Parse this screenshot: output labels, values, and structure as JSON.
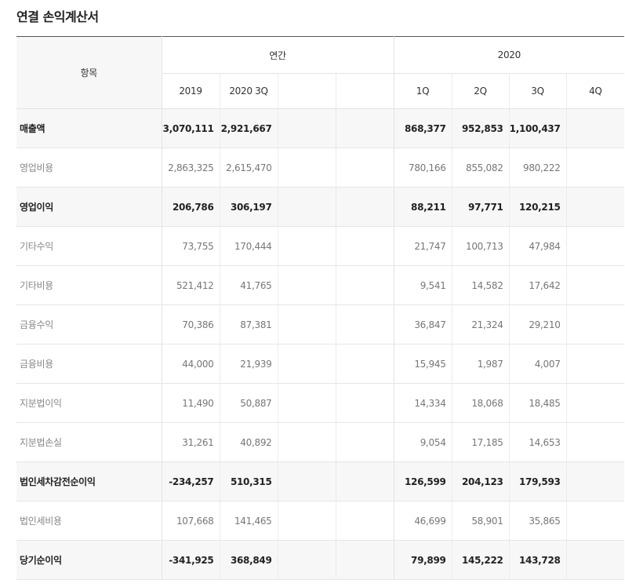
{
  "title": "연결 손익계산서",
  "table": {
    "item_header": "항목",
    "group_annual": "연간",
    "group_quarterly": "2020",
    "columns": [
      "2019",
      "2020 3Q",
      "",
      "",
      "1Q",
      "2Q",
      "3Q",
      "4Q"
    ],
    "rows": [
      {
        "label": "매출액",
        "emphasis": true,
        "values": [
          "3,070,111",
          "2,921,667",
          "",
          "",
          "868,377",
          "952,853",
          "1,100,437",
          ""
        ]
      },
      {
        "label": "영업비용",
        "emphasis": false,
        "values": [
          "2,863,325",
          "2,615,470",
          "",
          "",
          "780,166",
          "855,082",
          "980,222",
          ""
        ]
      },
      {
        "label": "영업이익",
        "emphasis": true,
        "values": [
          "206,786",
          "306,197",
          "",
          "",
          "88,211",
          "97,771",
          "120,215",
          ""
        ]
      },
      {
        "label": "기타수익",
        "emphasis": false,
        "values": [
          "73,755",
          "170,444",
          "",
          "",
          "21,747",
          "100,713",
          "47,984",
          ""
        ]
      },
      {
        "label": "기타비용",
        "emphasis": false,
        "values": [
          "521,412",
          "41,765",
          "",
          "",
          "9,541",
          "14,582",
          "17,642",
          ""
        ]
      },
      {
        "label": "금융수익",
        "emphasis": false,
        "values": [
          "70,386",
          "87,381",
          "",
          "",
          "36,847",
          "21,324",
          "29,210",
          ""
        ]
      },
      {
        "label": "금융비용",
        "emphasis": false,
        "values": [
          "44,000",
          "21,939",
          "",
          "",
          "15,945",
          "1,987",
          "4,007",
          ""
        ]
      },
      {
        "label": "지분법이익",
        "emphasis": false,
        "values": [
          "11,490",
          "50,887",
          "",
          "",
          "14,334",
          "18,068",
          "18,485",
          ""
        ]
      },
      {
        "label": "지분법손실",
        "emphasis": false,
        "values": [
          "31,261",
          "40,892",
          "",
          "",
          "9,054",
          "17,185",
          "14,653",
          ""
        ]
      },
      {
        "label": "법인세차감전순이익",
        "emphasis": true,
        "values": [
          "-234,257",
          "510,315",
          "",
          "",
          "126,599",
          "204,123",
          "179,593",
          ""
        ]
      },
      {
        "label": "법인세비용",
        "emphasis": false,
        "values": [
          "107,668",
          "141,465",
          "",
          "",
          "46,699",
          "58,901",
          "35,865",
          ""
        ]
      },
      {
        "label": "당기순이익",
        "emphasis": true,
        "values": [
          "-341,925",
          "368,849",
          "",
          "",
          "79,899",
          "145,222",
          "143,728",
          ""
        ]
      }
    ]
  }
}
